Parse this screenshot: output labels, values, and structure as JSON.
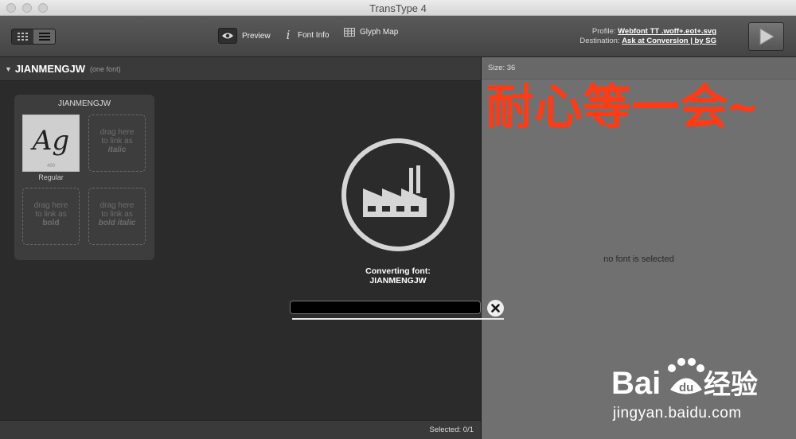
{
  "window": {
    "title": "TransType 4"
  },
  "toolbar": {
    "preview_label": "Preview",
    "font_info_label": "Font Info",
    "glyph_map_label": "Glyph Map",
    "profile_label": "Profile:",
    "profile_value": "Webfont TT .woff+.eot+.svg",
    "destination_label": "Destination:",
    "destination_value": "Ask at Conversion | by SG"
  },
  "left_panel": {
    "family_name": "JIANMENGJW",
    "family_count": "(one font)",
    "group_title": "JIANMENGJW",
    "tile": {
      "glyph": "Ag",
      "weight": "400",
      "caption": "Regular"
    },
    "drop_italic": {
      "line1": "drag here",
      "line2": "to link as",
      "style": "italic"
    },
    "drop_bold": {
      "line1": "drag here",
      "line2": "to link as",
      "style": "bold"
    },
    "drop_bold_italic": {
      "line1": "drag here",
      "line2": "to link as",
      "style": "bold italic"
    },
    "status": "Selected: 0/1"
  },
  "conversion": {
    "label_line1": "Converting font:",
    "label_line2": "JIANMENGJW",
    "progress": 1.0
  },
  "right_panel": {
    "size_label": "Size: 36",
    "empty_message": "no font is selected"
  },
  "annotation": {
    "text": "耐心等一会~",
    "color": "#ff3b15"
  },
  "watermark": {
    "brand_latin": "Bai",
    "brand_cn": "经验",
    "url": "jingyan.baidu.com"
  }
}
